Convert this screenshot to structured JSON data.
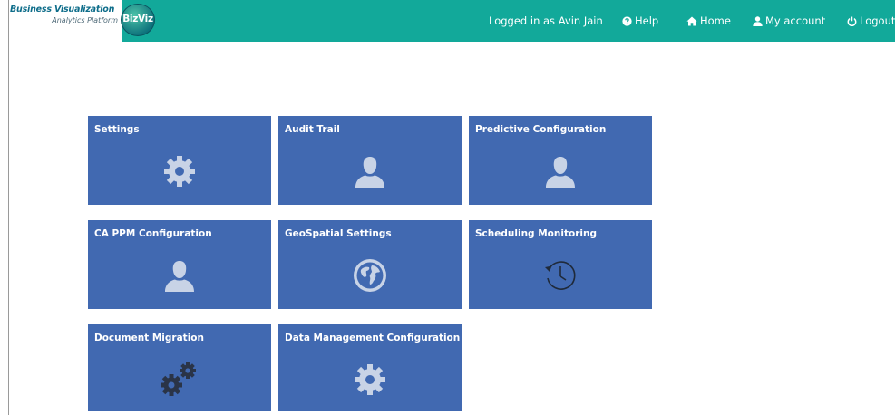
{
  "header": {
    "logo_line1": "Business Visualization",
    "logo_line2": "Analytics Platform",
    "logo_badge": "BizViz",
    "logged_in": "Logged in as Avin Jain",
    "nav": {
      "help": "Help",
      "home": "Home",
      "account": "My account",
      "logout": "Logout"
    },
    "colors": {
      "bar": "#12a99a",
      "tile": "#4169b1",
      "icon": "#c8d3e6"
    }
  },
  "tiles": [
    {
      "label": "Settings",
      "icon": "gear-icon"
    },
    {
      "label": "Audit Trail",
      "icon": "user-icon"
    },
    {
      "label": "Predictive Configuration",
      "icon": "user-icon"
    },
    {
      "label": "CA PPM Configuration",
      "icon": "user-icon"
    },
    {
      "label": "GeoSpatial Settings",
      "icon": "globe-icon"
    },
    {
      "label": "Scheduling Monitoring",
      "icon": "history-clock-icon"
    },
    {
      "label": "Document Migration",
      "icon": "gears-icon"
    },
    {
      "label": "Data Management Configuration",
      "icon": "gear-icon"
    }
  ]
}
